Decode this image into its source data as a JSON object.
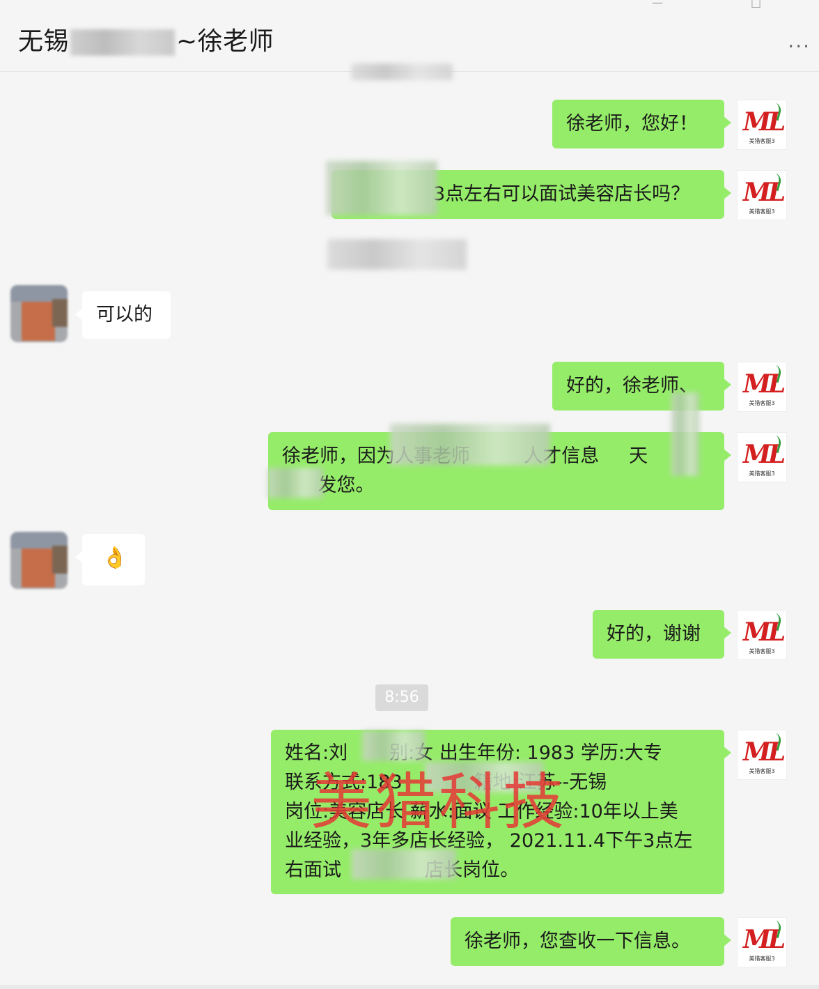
{
  "header": {
    "title_prefix": "无锡",
    "title_suffix": "~徐老师",
    "more_label": "···",
    "win_controls": [
      "—",
      "□"
    ]
  },
  "timestamps": {
    "second": "8:56"
  },
  "messages": [
    {
      "side": "me",
      "text": "徐老师，您好！"
    },
    {
      "side": "me",
      "text": "3点左右可以面试美容店长吗？"
    },
    {
      "side": "other",
      "text": "可以的"
    },
    {
      "side": "me",
      "text": "好的，徐老师、"
    },
    {
      "side": "me",
      "text": "徐老师，因为人事老师         人才信息     天\n      发您。"
    },
    {
      "side": "other",
      "text": "👌"
    },
    {
      "side": "me",
      "text": "好的，谢谢"
    },
    {
      "side": "me",
      "text": "姓名:刘       别:女 出生年份: 1983 学历:大专\n联系方式:183            籍地:江苏--无锡\n岗位:美容店长 薪水:面议 工作经验:10年以上美\n业经验，3年多店长经验， 2021.11.4下午3点左\n右面试              店长岗位。"
    },
    {
      "side": "me",
      "text": "徐老师，您查收一下信息。"
    }
  ],
  "avatar_me": {
    "logo_letter": "ML",
    "caption": "美猎客服3",
    "logo_color": "#d31f1f",
    "leaf_color": "#2e9c3a"
  },
  "watermark": "美猎科技",
  "colors": {
    "bubble_me": "#95ec69",
    "bubble_other": "#ffffff",
    "background": "#f5f5f5",
    "watermark": "#e53935"
  }
}
